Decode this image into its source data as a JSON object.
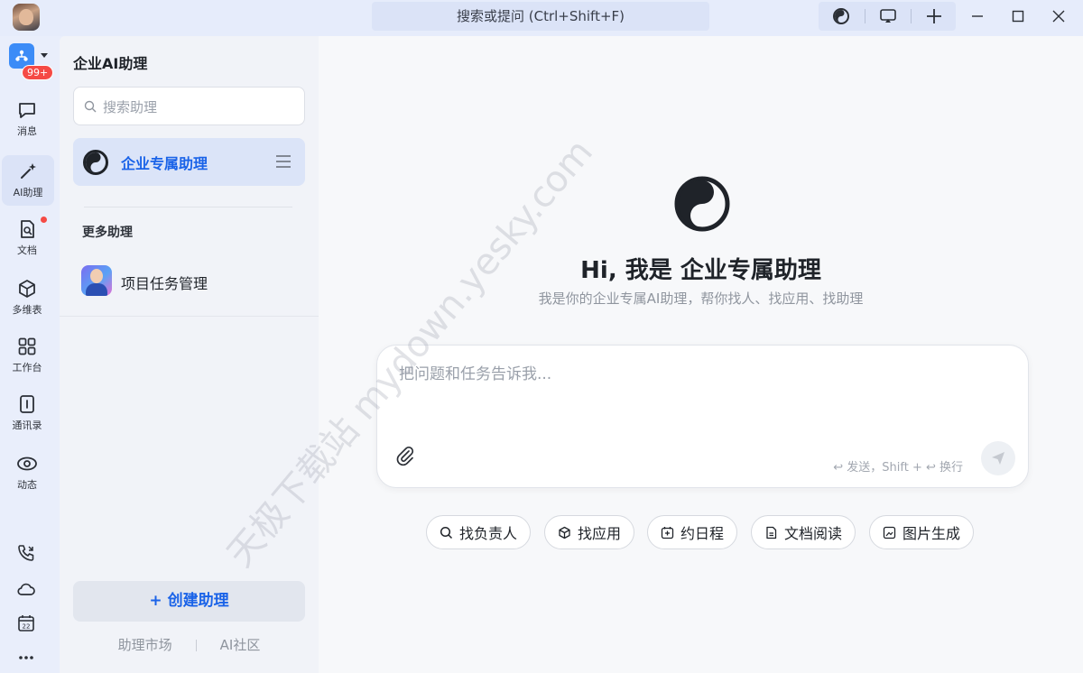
{
  "titlebar": {
    "search_placeholder": "搜索或提问 (Ctrl+Shift+F)"
  },
  "rail": {
    "badge": "99+",
    "items": [
      {
        "label": "消息",
        "icon": "message-icon"
      },
      {
        "label": "AI助理",
        "icon": "ai-sparkle-icon"
      },
      {
        "label": "文档",
        "icon": "document-icon"
      },
      {
        "label": "多维表",
        "icon": "base-table-icon"
      },
      {
        "label": "工作台",
        "icon": "workplace-grid-icon"
      },
      {
        "label": "通讯录",
        "icon": "contacts-icon"
      },
      {
        "label": "动态",
        "icon": "moments-eye-icon"
      }
    ]
  },
  "panel": {
    "title": "企业AI助理",
    "search_placeholder": "搜索助理",
    "active_assistant": "企业专属助理",
    "more_title": "更多助理",
    "more_items": [
      {
        "name": "项目任务管理"
      }
    ],
    "create_label": "+ 创建助理",
    "links": [
      "助理市场",
      "AI社区"
    ]
  },
  "main": {
    "title": "Hi, 我是 企业专属助理",
    "subtitle": "我是你的企业专属AI助理，帮你找人、找应用、找助理",
    "input_placeholder": "把问题和任务告诉我...",
    "hint": "↩ 发送，Shift + ↩ 换行",
    "chips": [
      "找负责人",
      "找应用",
      "约日程",
      "文档阅读",
      "图片生成"
    ]
  },
  "watermark": "天极下载站 mydown.yesky.com",
  "colors": {
    "accent": "#1a63e8",
    "badge_red": "#f54a45",
    "rail_bg": "#e9eefb",
    "main_bg": "#f7f8fa"
  }
}
